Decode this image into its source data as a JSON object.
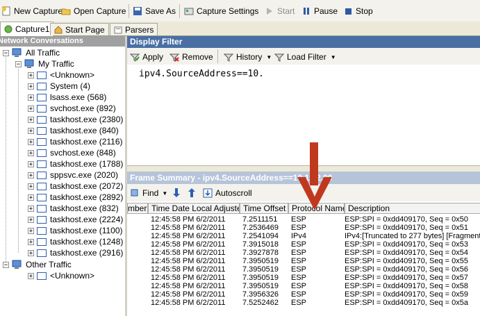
{
  "toolbar": {
    "new_capture": "New Capture",
    "open_capture": "Open Capture",
    "save_as": "Save As",
    "capture_settings": "Capture Settings",
    "start": "Start",
    "pause": "Pause",
    "stop": "Stop"
  },
  "tabs": {
    "capture": "Capture1",
    "start_page": "Start Page",
    "parsers": "Parsers"
  },
  "network_conversations": {
    "title": "Network Conversations",
    "all_traffic": "All Traffic",
    "my_traffic": "My Traffic",
    "items": [
      "<Unknown>",
      "System (4)",
      "lsass.exe (568)",
      "svchost.exe (892)",
      "taskhost.exe (2380)",
      "taskhost.exe (840)",
      "taskhost.exe (2116)",
      "svchost.exe (848)",
      "taskhost.exe (1788)",
      "sppsvc.exe (2020)",
      "taskhost.exe (2072)",
      "taskhost.exe (2892)",
      "taskhost.exe (832)",
      "taskhost.exe (2224)",
      "taskhost.exe (1100)",
      "taskhost.exe (1248)",
      "taskhost.exe (2916)"
    ],
    "other_traffic": "Other Traffic",
    "other_unknown": "<Unknown>"
  },
  "display_filter": {
    "title": "Display Filter",
    "apply": "Apply",
    "remove": "Remove",
    "history": "History",
    "load_filter": "Load Filter",
    "text": "ipv4.SourceAddress==10."
  },
  "frame_summary": {
    "title": "Frame Summary - ipv4.SourceAddress==10.12.2.90",
    "find": "Find",
    "autoscroll": "Autoscroll",
    "columns": [
      "mber",
      "Time Date Local Adjusted",
      "Time Offset",
      "Protocol Name",
      "Description"
    ],
    "rows": [
      [
        "12:45:58 PM 6/2/2011",
        "7.2511151",
        "ESP",
        "ESP:SPI = 0xdd409170, Seq = 0x50"
      ],
      [
        "12:45:58 PM 6/2/2011",
        "7.2536469",
        "ESP",
        "ESP:SPI = 0xdd409170, Seq = 0x51"
      ],
      [
        "12:45:58 PM 6/2/2011",
        "7.2541094",
        "IPv4",
        "IPv4:[Truncated to 277 bytes] [Fragment"
      ],
      [
        "12:45:58 PM 6/2/2011",
        "7.3915018",
        "ESP",
        "ESP:SPI = 0xdd409170, Seq = 0x53"
      ],
      [
        "12:45:58 PM 6/2/2011",
        "7.3927878",
        "ESP",
        "ESP:SPI = 0xdd409170, Seq = 0x54"
      ],
      [
        "12:45:58 PM 6/2/2011",
        "7.3950519",
        "ESP",
        "ESP:SPI = 0xdd409170, Seq = 0x55"
      ],
      [
        "12:45:58 PM 6/2/2011",
        "7.3950519",
        "ESP",
        "ESP:SPI = 0xdd409170, Seq = 0x56"
      ],
      [
        "12:45:58 PM 6/2/2011",
        "7.3950519",
        "ESP",
        "ESP:SPI = 0xdd409170, Seq = 0x57"
      ],
      [
        "12:45:58 PM 6/2/2011",
        "7.3950519",
        "ESP",
        "ESP:SPI = 0xdd409170, Seq = 0x58"
      ],
      [
        "12:45:58 PM 6/2/2011",
        "7.3956326",
        "ESP",
        "ESP:SPI = 0xdd409170, Seq = 0x59"
      ],
      [
        "12:45:58 PM 6/2/2011",
        "7.5252462",
        "ESP",
        "ESP:SPI = 0xdd409170, Seq = 0x5a"
      ]
    ]
  },
  "colors": {
    "panel_header": "#4a6fa5",
    "inactive_header": "#a0a0a0",
    "annotation_arrow": "#c0391f"
  },
  "icons": [
    "new-capture-icon",
    "open-folder-icon",
    "save-icon",
    "settings-icon",
    "play-icon",
    "pause-icon",
    "stop-icon",
    "apply-icon",
    "remove-icon",
    "history-icon",
    "load-filter-icon",
    "find-icon",
    "down-arrow-icon",
    "up-arrow-icon",
    "autoscroll-icon",
    "computer-icon"
  ]
}
